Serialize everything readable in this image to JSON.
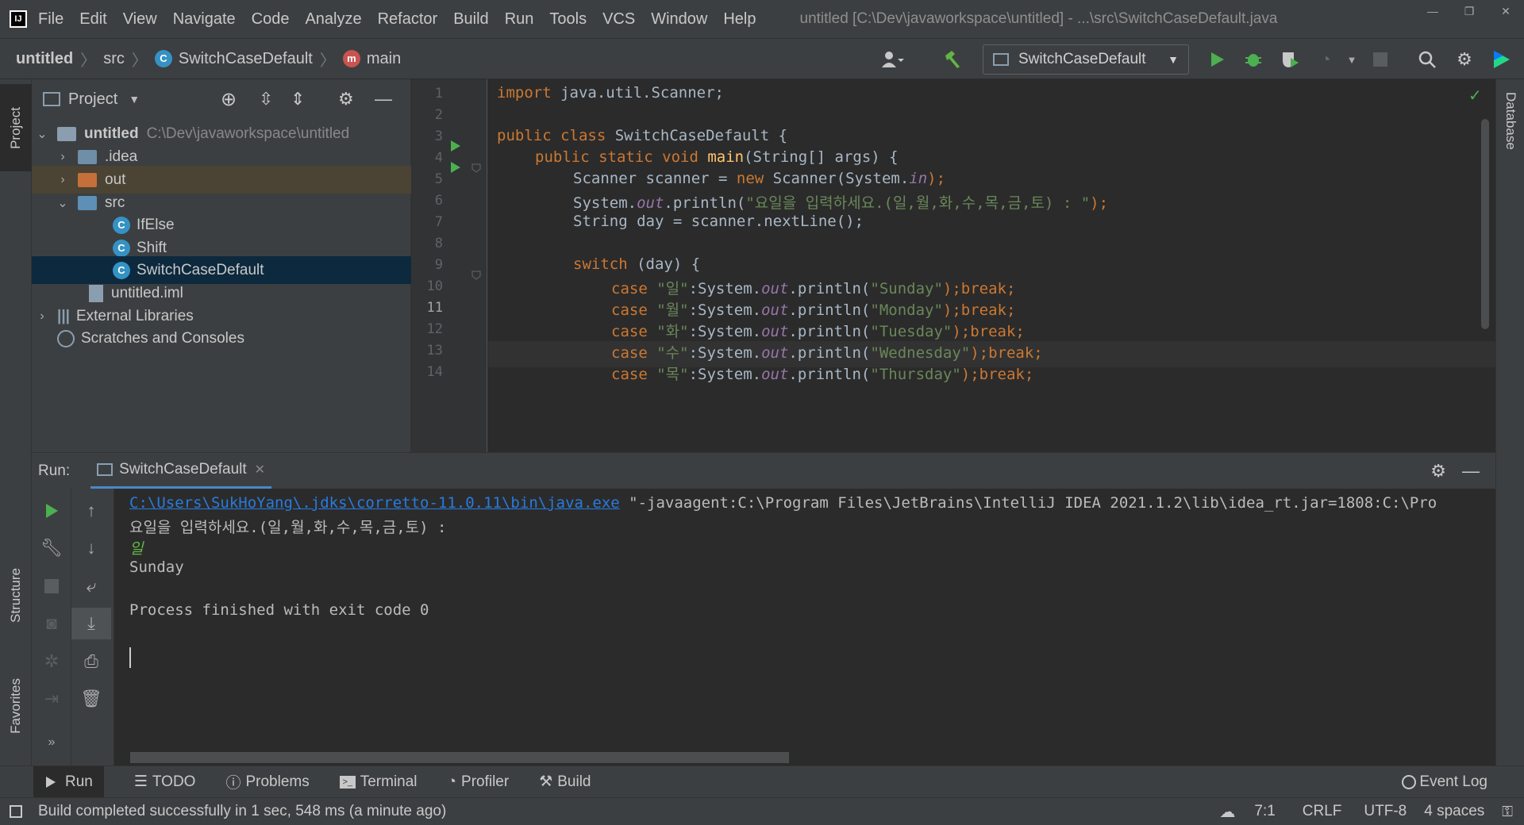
{
  "menu": {
    "items": [
      "File",
      "Edit",
      "View",
      "Navigate",
      "Code",
      "Analyze",
      "Refactor",
      "Build",
      "Run",
      "Tools",
      "VCS",
      "Window",
      "Help"
    ],
    "title": "untitled [C:\\Dev\\javaworkspace\\untitled] - ...\\src\\SwitchCaseDefault.java"
  },
  "breadcrumb": {
    "project": "untitled",
    "folder": "src",
    "file": "SwitchCaseDefault",
    "method": "main"
  },
  "run_config": "SwitchCaseDefault",
  "left_tabs": {
    "project": "Project",
    "structure": "Structure",
    "favorites": "Favorites"
  },
  "right_tabs": {
    "database": "Database"
  },
  "project_panel": {
    "title": "Project",
    "root_name": "untitled",
    "root_path": "C:\\Dev\\javaworkspace\\untitled",
    "idea": ".idea",
    "out": "out",
    "src": "src",
    "files": [
      "IfElse",
      "Shift",
      "SwitchCaseDefault"
    ],
    "iml": "untitled.iml",
    "ext_libs": "External Libraries",
    "scratches": "Scratches and Consoles"
  },
  "editor": {
    "line_numbers": [
      "1",
      "2",
      "3",
      "4",
      "5",
      "6",
      "7",
      "8",
      "9",
      "10",
      "11",
      "12",
      "13",
      "14"
    ],
    "l1_kw": "import ",
    "l1_rest": "java.util.Scanner;",
    "l3_kw": "public class ",
    "l3_rest": "SwitchCaseDefault {",
    "l4_kw": "public static void ",
    "l4_fn": "main",
    "l4_rest": "(String[] args) {",
    "l5_a": "Scanner scanner = ",
    "l5_kw": "new ",
    "l5_b": "Scanner(System.",
    "l5_fld": "in",
    "l5_c": ");",
    "sys": "System.",
    "out_fld": "out",
    "println": ".println(",
    "l6_str": "\"요일을 입력하세요.(일,월,화,수,목,금,토) : \"",
    "l6_end": ");",
    "l7": "String day = scanner.nextLine();",
    "l9_kw": "switch ",
    "l9_rest": "(day) {",
    "case_kw": "case ",
    "break_kw": "break;",
    "case_end": ");",
    "cases": [
      {
        "key": "\"일\"",
        "val": "\"Sunday\""
      },
      {
        "key": "\"월\"",
        "val": "\"Monday\""
      },
      {
        "key": "\"화\"",
        "val": "\"Tuesday\""
      },
      {
        "key": "\"수\"",
        "val": "\"Wednesday\""
      },
      {
        "key": "\"목\"",
        "val": "\"Thursday\""
      }
    ],
    "colon": ":"
  },
  "run": {
    "label": "Run:",
    "tab": "SwitchCaseDefault",
    "console": {
      "java_path": "C:\\Users\\SukHoYang\\.jdks\\corretto-11.0.11\\bin\\java.exe",
      "args": " \"-javaagent:C:\\Program Files\\JetBrains\\IntelliJ IDEA 2021.1.2\\lib\\idea_rt.jar=1808:C:\\Pro",
      "prompt": "요일을 입력하세요.(일,월,화,수,목,금,토) :",
      "input": "일",
      "output": "Sunday",
      "finish": "Process finished with exit code 0"
    }
  },
  "bottom_tabs": [
    "Run",
    "TODO",
    "Problems",
    "Terminal",
    "Profiler",
    "Build"
  ],
  "event_log": "Event Log",
  "status": {
    "message": "Build completed successfully in 1 sec, 548 ms (a minute ago)",
    "position": "7:1",
    "line_sep": "CRLF",
    "encoding": "UTF-8",
    "indent": "4 spaces"
  },
  "colors": {
    "keyword": "#cc7832",
    "string": "#6a8759",
    "field": "#9876aa",
    "function": "#ffc66d",
    "run_green": "#4caf50",
    "link": "#287bde"
  }
}
